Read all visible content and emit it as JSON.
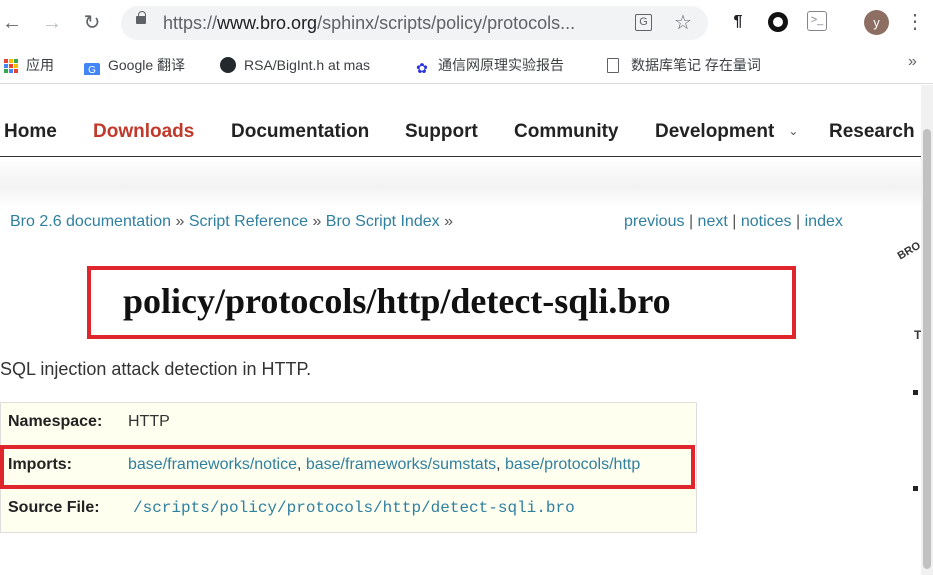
{
  "browser": {
    "url_prefix": "https://",
    "url_host": "www.bro.org",
    "url_path": "/sphinx/scripts/policy/protocols...",
    "avatar_letter": "y",
    "bookmarks": [
      {
        "label": "应用",
        "icon": "apps-grid-icon"
      },
      {
        "label": "Google 翻译",
        "icon": "google-translate-icon"
      },
      {
        "label": "RSA/BigInt.h at mas",
        "icon": "github-icon"
      },
      {
        "label": "通信网原理实验报告",
        "icon": "baidu-paw-icon"
      },
      {
        "label": "数据库笔记 存在量词",
        "icon": "page-icon"
      }
    ]
  },
  "nav": {
    "items": [
      "Home",
      "Downloads",
      "Documentation",
      "Support",
      "Community",
      "Development",
      "Research"
    ],
    "active": "Downloads"
  },
  "breadcrumb": {
    "items": [
      "Bro 2.6 documentation",
      "Script Reference",
      "Bro Script Index"
    ],
    "separator": "»"
  },
  "relnav": {
    "items": [
      "previous",
      "next",
      "notices",
      "index"
    ],
    "separator": "|"
  },
  "sidebar": {
    "label": "BRO",
    "heading_letter": "T"
  },
  "page": {
    "title": "policy/protocols/http/detect-sqli.bro",
    "description": "SQL injection attack detection in HTTP.",
    "namespace_label": "Namespace:",
    "namespace_value": "HTTP",
    "imports_label": "Imports:",
    "imports": [
      "base/frameworks/notice",
      "base/frameworks/sumstats",
      "base/protocols/http"
    ],
    "source_label": "Source File:",
    "source_value": "/scripts/policy/protocols/http/detect-sqli.bro"
  },
  "colors": {
    "link": "#2f7f9f",
    "active_nav": "#c0392b",
    "highlight_border": "#e0262d",
    "info_bg": "#fffff0"
  }
}
